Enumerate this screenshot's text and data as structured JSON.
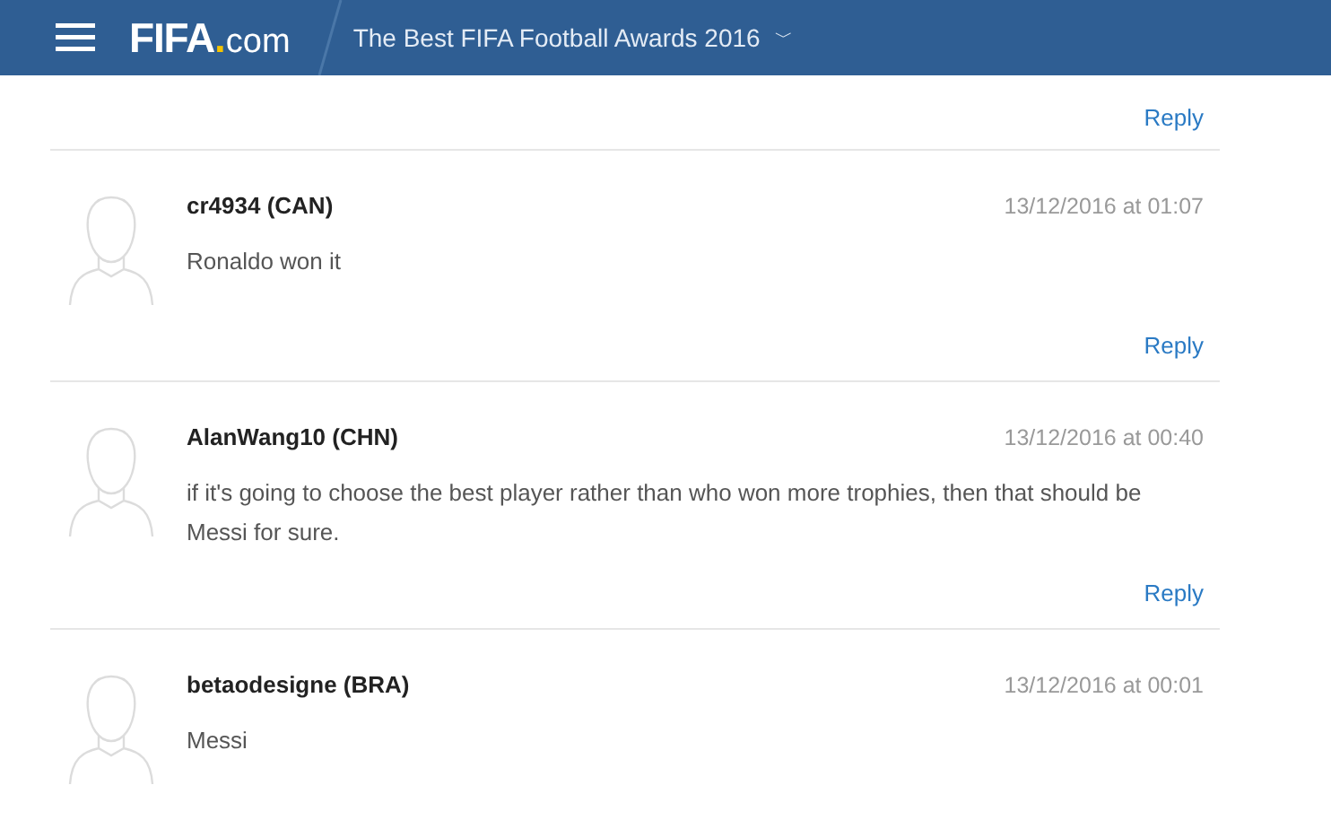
{
  "header": {
    "logo": {
      "brand": "FIFA",
      "dot": ".",
      "suffix": "com"
    },
    "title": "The Best FIFA Football Awards 2016",
    "caret": "﹀"
  },
  "top_reply": "Reply",
  "comments": [
    {
      "author": "cr4934 (CAN)",
      "date": "13/12/2016 at 01:07",
      "text": "Ronaldo won it",
      "reply": "Reply"
    },
    {
      "author": "AlanWang10 (CHN)",
      "date": "13/12/2016 at 00:40",
      "text": "if it's going to choose the best player rather than who won more trophies, then that should be Messi for sure.",
      "reply": "Reply"
    },
    {
      "author": "betaodesigne (BRA)",
      "date": "13/12/2016 at 00:01",
      "text": "Messi"
    }
  ]
}
